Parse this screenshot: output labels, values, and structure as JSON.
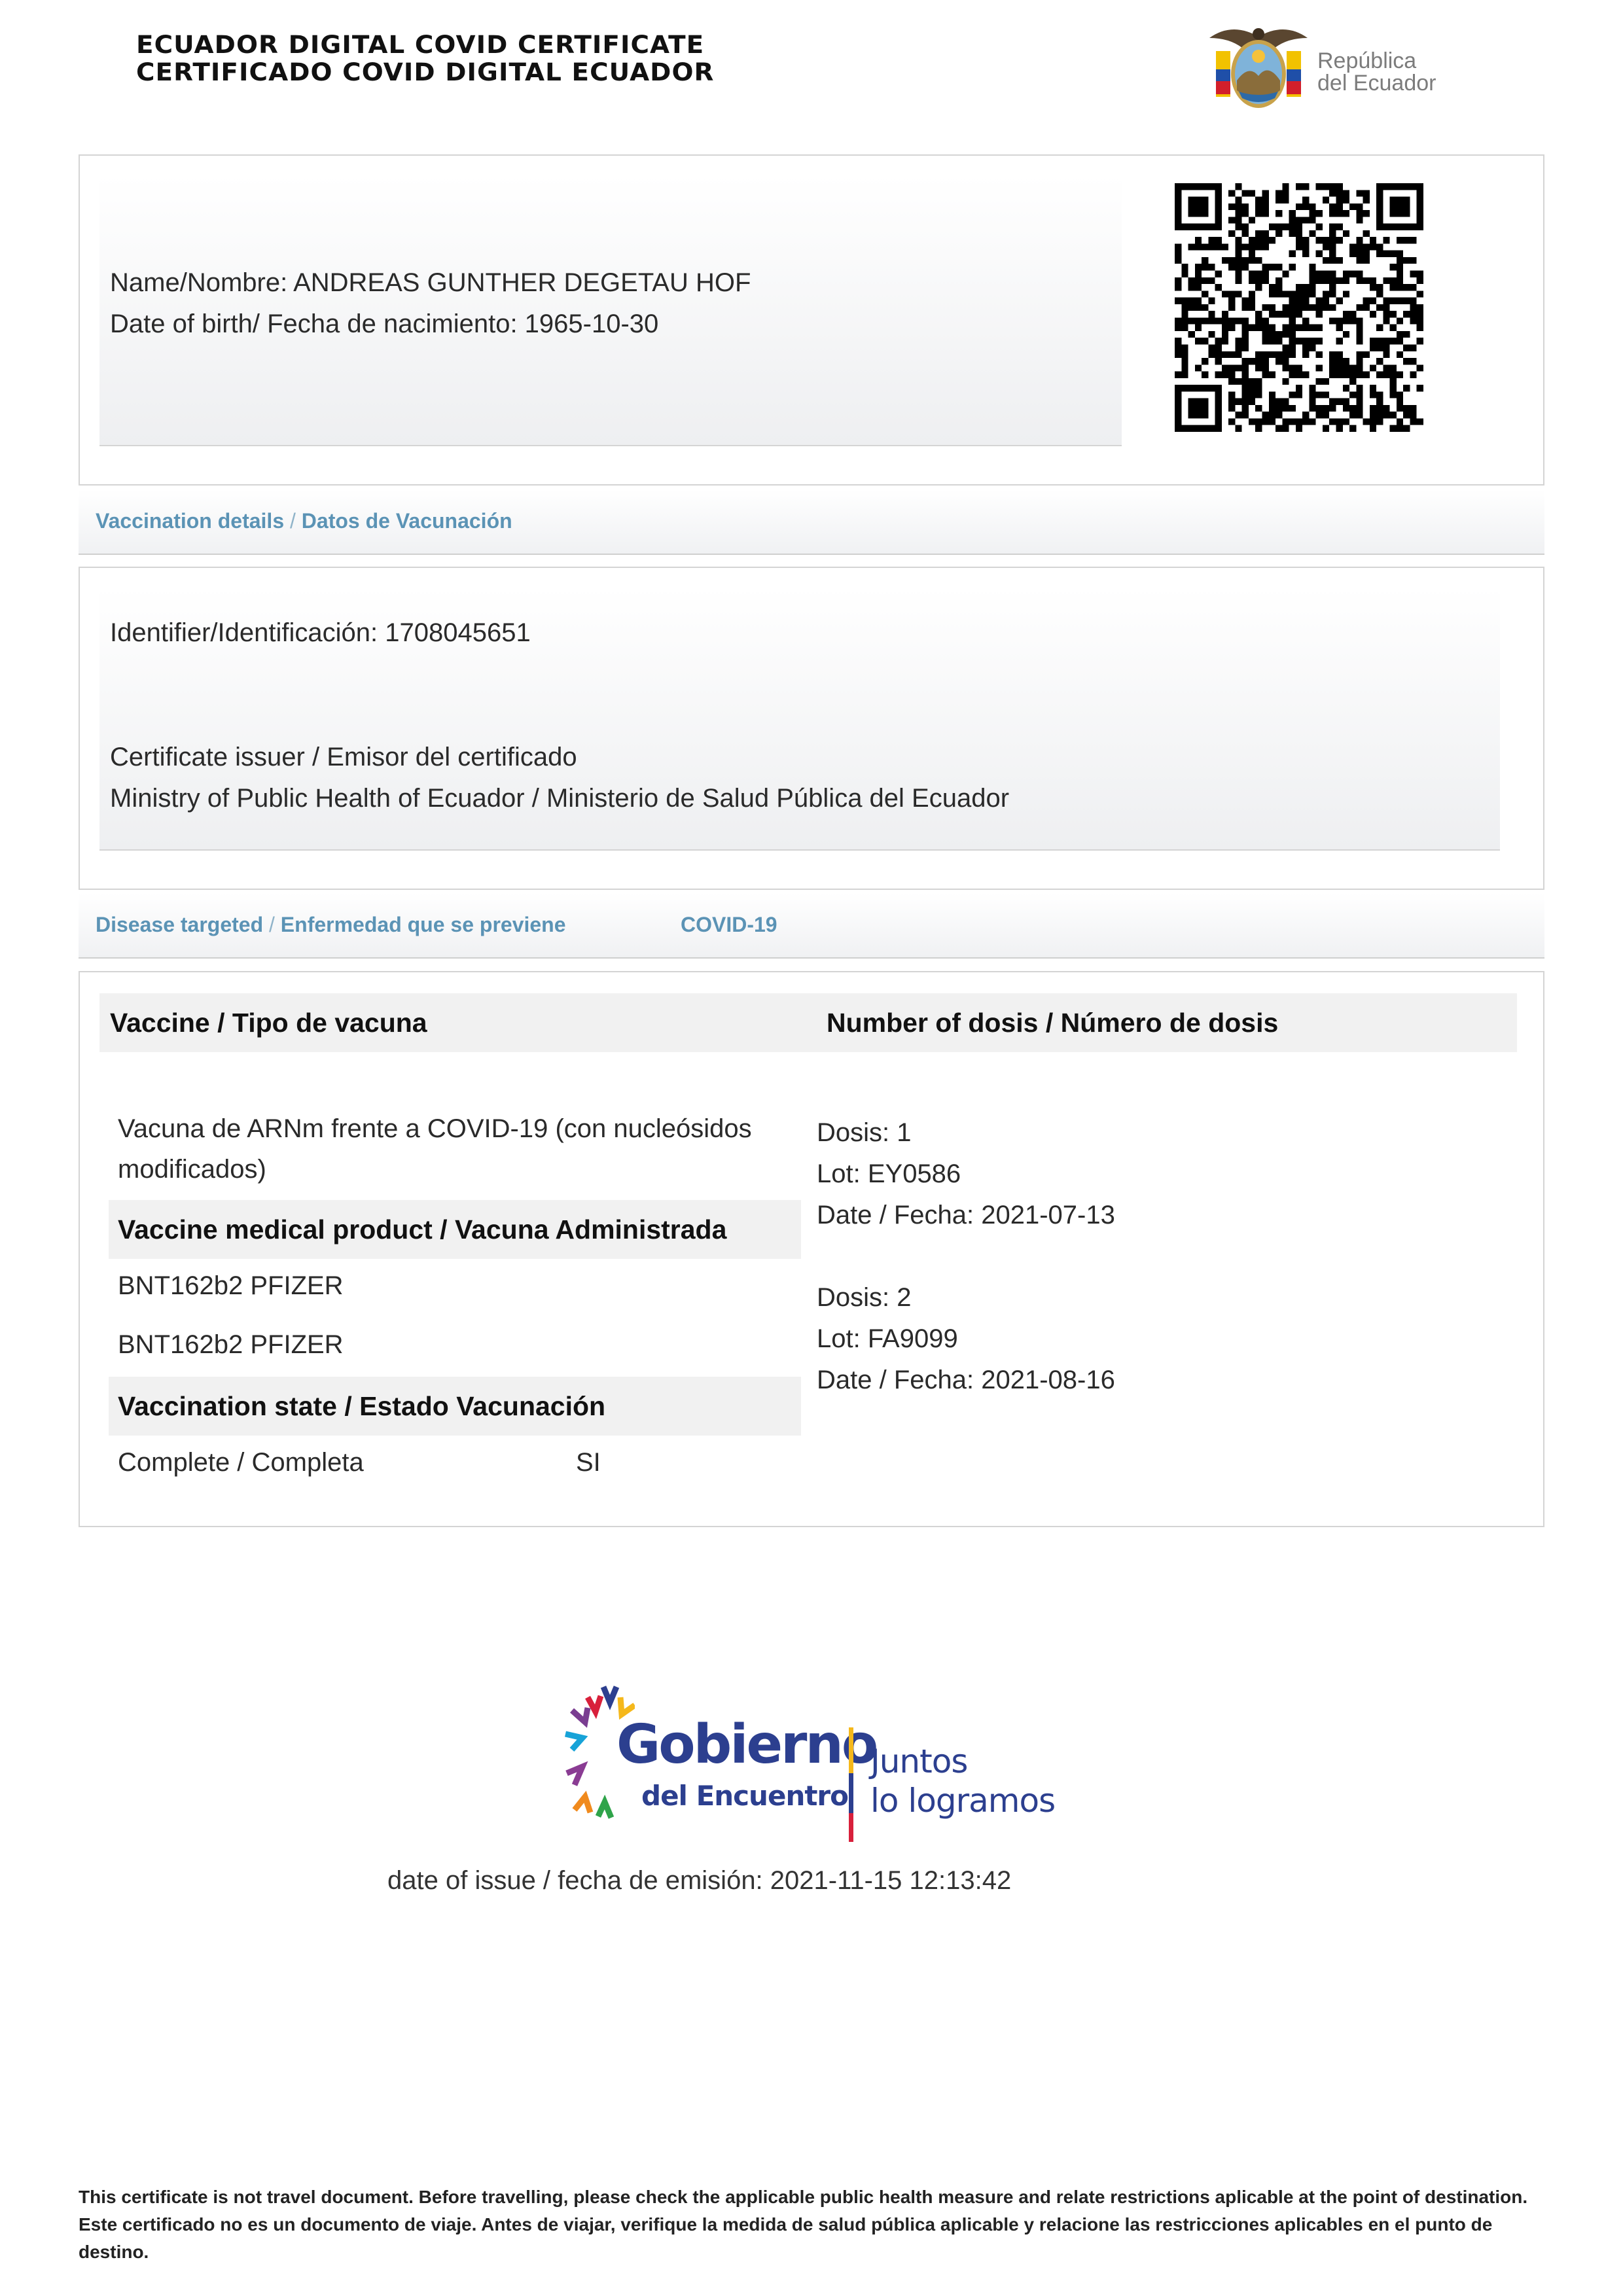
{
  "header": {
    "title_en": "ECUADOR DIGITAL COVID CERTIFICATE",
    "title_es": "CERTIFICADO COVID DIGITAL ECUADOR",
    "logo_text_1": "República",
    "logo_text_2": "del Ecuador"
  },
  "person": {
    "name_line": "Name/Nombre: ANDREAS GUNTHER DEGETAU HOF",
    "dob_line": "Date of birth/ Fecha de nacimiento: 1965-10-30"
  },
  "vaccination_bar": {
    "label_en": "Vaccination details",
    "label_es": "Datos de Vacunación"
  },
  "details": {
    "identifier_label": "Identifier/Identificación:",
    "identifier_value": "1708045651",
    "issuer_label": "Certificate issuer / Emisor del certificado",
    "issuer_value": "Ministry of Public Health of Ecuador / Ministerio de Salud Pública del Ecuador"
  },
  "disease_bar": {
    "label_en": "Disease targeted",
    "label_es": "Enfermedad que se previene",
    "value": "COVID-19"
  },
  "vaccine": {
    "col1_header": "Vaccine / Tipo de vacuna",
    "col2_header": "Number of dosis / Número de dosis",
    "type_line1": "Vacuna de ARNm frente a COVID-19 (con nucleósidos",
    "type_line2": "modificados)",
    "product_header": "Vaccine medical product / Vacuna Administrada",
    "products": [
      "BNT162b2 PFIZER",
      "BNT162b2 PFIZER"
    ],
    "state_header": "Vaccination state / Estado Vacunación",
    "state_label": "Complete / Completa",
    "state_value": "SI",
    "doses": [
      {
        "dose": "Dosis: 1",
        "lot": "Lot: EY0586",
        "date": "Date / Fecha: 2021-07-13"
      },
      {
        "dose": "Dosis: 2",
        "lot": "Lot: FA9099",
        "date": "Date / Fecha: 2021-08-16"
      }
    ]
  },
  "gobierno_logo": {
    "line1": "Gobierno",
    "line2": "del Encuentro",
    "slogan1": "Juntos",
    "slogan2": "lo logramos"
  },
  "issue": {
    "text": "date of issue / fecha de emisión: 2021-11-15 12:13:42"
  },
  "footer": {
    "note": "This certificate is not travel document. Before travelling, please check the applicable public health measure and relate restrictions aplicable at the point of destination. Este certificado no es un documento de viaje. Antes de viajar, verifique la medida de salud pública aplicable y relacione las restricciones aplicables en el punto de destino."
  }
}
